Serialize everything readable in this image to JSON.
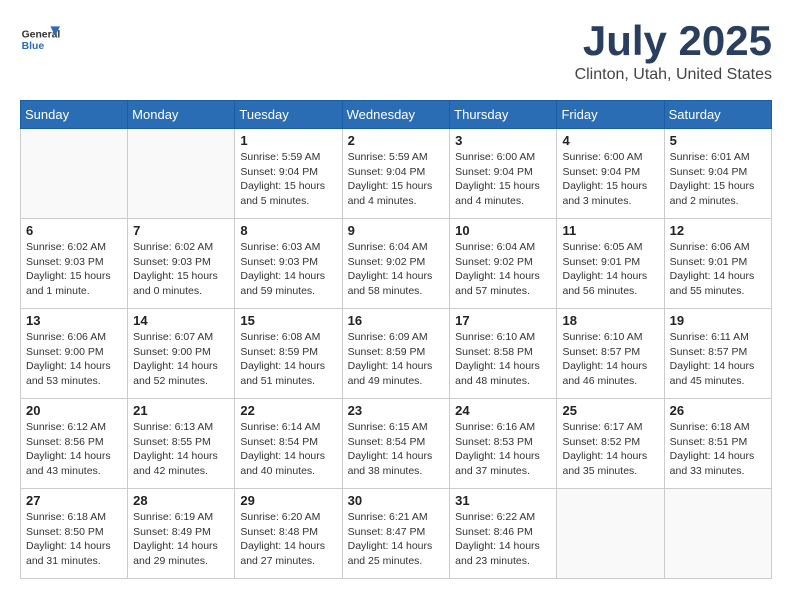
{
  "header": {
    "logo_general": "General",
    "logo_blue": "Blue",
    "month_title": "July 2025",
    "location": "Clinton, Utah, United States"
  },
  "days_of_week": [
    "Sunday",
    "Monday",
    "Tuesday",
    "Wednesday",
    "Thursday",
    "Friday",
    "Saturday"
  ],
  "weeks": [
    [
      {
        "day": "",
        "info": ""
      },
      {
        "day": "",
        "info": ""
      },
      {
        "day": "1",
        "info": "Sunrise: 5:59 AM\nSunset: 9:04 PM\nDaylight: 15 hours and 5 minutes."
      },
      {
        "day": "2",
        "info": "Sunrise: 5:59 AM\nSunset: 9:04 PM\nDaylight: 15 hours and 4 minutes."
      },
      {
        "day": "3",
        "info": "Sunrise: 6:00 AM\nSunset: 9:04 PM\nDaylight: 15 hours and 4 minutes."
      },
      {
        "day": "4",
        "info": "Sunrise: 6:00 AM\nSunset: 9:04 PM\nDaylight: 15 hours and 3 minutes."
      },
      {
        "day": "5",
        "info": "Sunrise: 6:01 AM\nSunset: 9:04 PM\nDaylight: 15 hours and 2 minutes."
      }
    ],
    [
      {
        "day": "6",
        "info": "Sunrise: 6:02 AM\nSunset: 9:03 PM\nDaylight: 15 hours and 1 minute."
      },
      {
        "day": "7",
        "info": "Sunrise: 6:02 AM\nSunset: 9:03 PM\nDaylight: 15 hours and 0 minutes."
      },
      {
        "day": "8",
        "info": "Sunrise: 6:03 AM\nSunset: 9:03 PM\nDaylight: 14 hours and 59 minutes."
      },
      {
        "day": "9",
        "info": "Sunrise: 6:04 AM\nSunset: 9:02 PM\nDaylight: 14 hours and 58 minutes."
      },
      {
        "day": "10",
        "info": "Sunrise: 6:04 AM\nSunset: 9:02 PM\nDaylight: 14 hours and 57 minutes."
      },
      {
        "day": "11",
        "info": "Sunrise: 6:05 AM\nSunset: 9:01 PM\nDaylight: 14 hours and 56 minutes."
      },
      {
        "day": "12",
        "info": "Sunrise: 6:06 AM\nSunset: 9:01 PM\nDaylight: 14 hours and 55 minutes."
      }
    ],
    [
      {
        "day": "13",
        "info": "Sunrise: 6:06 AM\nSunset: 9:00 PM\nDaylight: 14 hours and 53 minutes."
      },
      {
        "day": "14",
        "info": "Sunrise: 6:07 AM\nSunset: 9:00 PM\nDaylight: 14 hours and 52 minutes."
      },
      {
        "day": "15",
        "info": "Sunrise: 6:08 AM\nSunset: 8:59 PM\nDaylight: 14 hours and 51 minutes."
      },
      {
        "day": "16",
        "info": "Sunrise: 6:09 AM\nSunset: 8:59 PM\nDaylight: 14 hours and 49 minutes."
      },
      {
        "day": "17",
        "info": "Sunrise: 6:10 AM\nSunset: 8:58 PM\nDaylight: 14 hours and 48 minutes."
      },
      {
        "day": "18",
        "info": "Sunrise: 6:10 AM\nSunset: 8:57 PM\nDaylight: 14 hours and 46 minutes."
      },
      {
        "day": "19",
        "info": "Sunrise: 6:11 AM\nSunset: 8:57 PM\nDaylight: 14 hours and 45 minutes."
      }
    ],
    [
      {
        "day": "20",
        "info": "Sunrise: 6:12 AM\nSunset: 8:56 PM\nDaylight: 14 hours and 43 minutes."
      },
      {
        "day": "21",
        "info": "Sunrise: 6:13 AM\nSunset: 8:55 PM\nDaylight: 14 hours and 42 minutes."
      },
      {
        "day": "22",
        "info": "Sunrise: 6:14 AM\nSunset: 8:54 PM\nDaylight: 14 hours and 40 minutes."
      },
      {
        "day": "23",
        "info": "Sunrise: 6:15 AM\nSunset: 8:54 PM\nDaylight: 14 hours and 38 minutes."
      },
      {
        "day": "24",
        "info": "Sunrise: 6:16 AM\nSunset: 8:53 PM\nDaylight: 14 hours and 37 minutes."
      },
      {
        "day": "25",
        "info": "Sunrise: 6:17 AM\nSunset: 8:52 PM\nDaylight: 14 hours and 35 minutes."
      },
      {
        "day": "26",
        "info": "Sunrise: 6:18 AM\nSunset: 8:51 PM\nDaylight: 14 hours and 33 minutes."
      }
    ],
    [
      {
        "day": "27",
        "info": "Sunrise: 6:18 AM\nSunset: 8:50 PM\nDaylight: 14 hours and 31 minutes."
      },
      {
        "day": "28",
        "info": "Sunrise: 6:19 AM\nSunset: 8:49 PM\nDaylight: 14 hours and 29 minutes."
      },
      {
        "day": "29",
        "info": "Sunrise: 6:20 AM\nSunset: 8:48 PM\nDaylight: 14 hours and 27 minutes."
      },
      {
        "day": "30",
        "info": "Sunrise: 6:21 AM\nSunset: 8:47 PM\nDaylight: 14 hours and 25 minutes."
      },
      {
        "day": "31",
        "info": "Sunrise: 6:22 AM\nSunset: 8:46 PM\nDaylight: 14 hours and 23 minutes."
      },
      {
        "day": "",
        "info": ""
      },
      {
        "day": "",
        "info": ""
      }
    ]
  ]
}
